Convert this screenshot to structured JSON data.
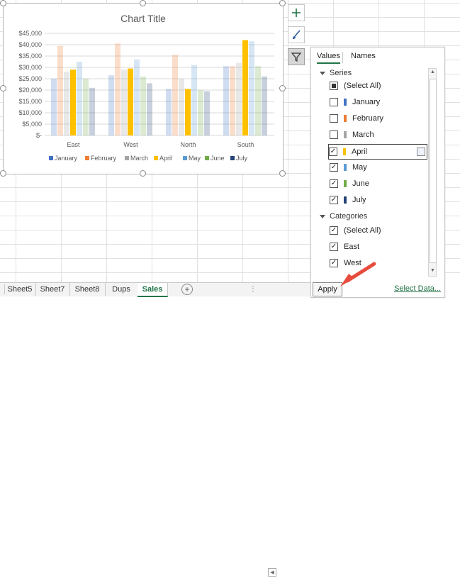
{
  "chart_data": {
    "type": "bar",
    "title": "Chart Title",
    "categories": [
      "East",
      "West",
      "North",
      "South"
    ],
    "y_ticks": [
      "$45,000",
      "$40,000",
      "$35,000",
      "$30,000",
      "$25,000",
      "$20,000",
      "$15,000",
      "$10,000",
      "$5,000",
      "$-"
    ],
    "ylim": [
      0,
      45000
    ],
    "legend_position": "bottom",
    "grid": true,
    "series": [
      {
        "name": "January",
        "color": "#4472c4",
        "values": [
          25000,
          26500,
          20500,
          30500
        ],
        "faded": true
      },
      {
        "name": "February",
        "color": "#ed7d31",
        "values": [
          39500,
          40500,
          35500,
          30500
        ],
        "faded": true
      },
      {
        "name": "March",
        "color": "#a5a5a5",
        "values": [
          28000,
          29000,
          25000,
          32000
        ],
        "faded": true
      },
      {
        "name": "April",
        "color": "#ffc000",
        "values": [
          29000,
          29500,
          20500,
          42000
        ],
        "faded": false
      },
      {
        "name": "May",
        "color": "#5b9bd5",
        "values": [
          32500,
          33500,
          31000,
          41500
        ],
        "faded": true
      },
      {
        "name": "June",
        "color": "#70ad47",
        "values": [
          25000,
          26000,
          20000,
          30500
        ],
        "faded": true
      },
      {
        "name": "July",
        "color": "#264478",
        "values": [
          21000,
          23000,
          19500,
          26000
        ],
        "faded": true
      }
    ]
  },
  "side_buttons": [
    {
      "icon": "plus-icon",
      "color": "#217346"
    },
    {
      "icon": "brush-icon",
      "color": "#2b579a"
    },
    {
      "icon": "filter-icon",
      "color": "#555555"
    }
  ],
  "filter_panel": {
    "tabs": [
      "Values",
      "Names"
    ],
    "active_tab": "Values",
    "series_heading": "Series",
    "series_items": [
      {
        "label": "(Select All)",
        "state": "partial",
        "color": ""
      },
      {
        "label": "January",
        "state": "unchecked",
        "color": "#4472c4"
      },
      {
        "label": "February",
        "state": "unchecked",
        "color": "#ed7d31"
      },
      {
        "label": "March",
        "state": "unchecked",
        "color": "#a5a5a5"
      },
      {
        "label": "April",
        "state": "checked",
        "color": "#ffc000"
      },
      {
        "label": "May",
        "state": "checked",
        "color": "#5b9bd5"
      },
      {
        "label": "June",
        "state": "checked",
        "color": "#70ad47"
      },
      {
        "label": "July",
        "state": "checked",
        "color": "#264478"
      }
    ],
    "categories_heading": "Categories",
    "category_items": [
      {
        "label": "(Select All)",
        "state": "checked"
      },
      {
        "label": "East",
        "state": "checked"
      },
      {
        "label": "West",
        "state": "checked"
      }
    ],
    "apply_label": "Apply",
    "select_data_label": "Select Data..."
  },
  "sheets": {
    "items": [
      "Sheet5",
      "Sheet7",
      "Sheet8",
      "Dups",
      "Sales"
    ],
    "active": "Sales",
    "add_symbol": "+"
  },
  "arrow_color": "#e74c3c"
}
